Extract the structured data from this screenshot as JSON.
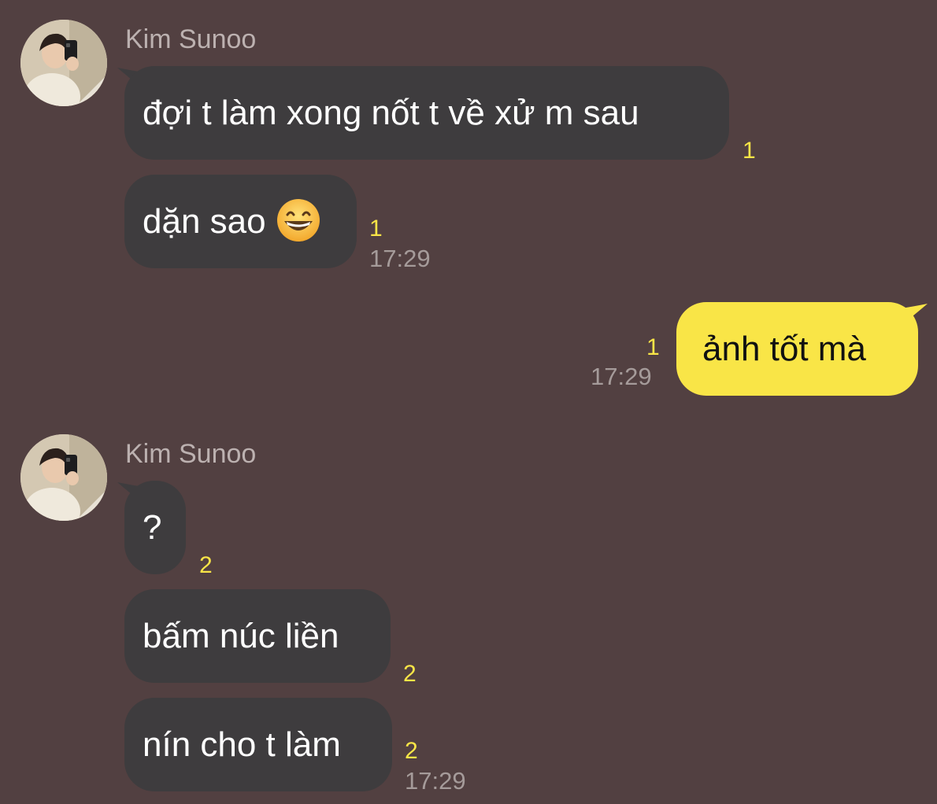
{
  "chat": {
    "groups": [
      {
        "sender": "Kim Sunoo",
        "avatar_icon": "profile-photo",
        "messages": [
          {
            "text": "đợi t làm xong nốt t về xử m sau",
            "unread": "1",
            "time": ""
          },
          {
            "text": "dặn sao",
            "emoji": "grinning-face-emoji",
            "unread": "1",
            "time": "17:29"
          }
        ]
      },
      {
        "sender": "me",
        "messages": [
          {
            "text": "ảnh tốt mà",
            "unread": "1",
            "time": "17:29"
          }
        ]
      },
      {
        "sender": "Kim Sunoo",
        "avatar_icon": "profile-photo",
        "messages": [
          {
            "text": "?",
            "unread": "2",
            "time": ""
          },
          {
            "text": "bấm núc liền",
            "unread": "2",
            "time": ""
          },
          {
            "text": "nín cho t làm",
            "unread": "2",
            "time": "17:29"
          }
        ]
      }
    ]
  },
  "colors": {
    "background": "#524041",
    "incoming_bubble": "#3e3c3e",
    "outgoing_bubble": "#f9e547",
    "unread_count": "#f9e547",
    "timestamp": "#a59b9a",
    "sender_name": "#bcb1b0"
  }
}
